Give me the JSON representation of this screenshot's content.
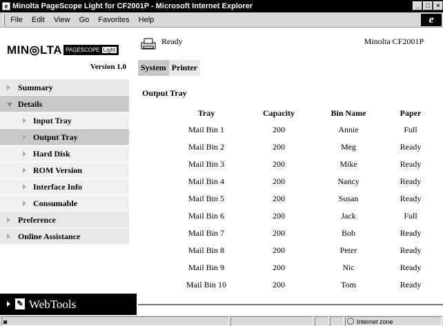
{
  "window": {
    "title": "Minolta PageScope Light for CF2001P - Microsoft Internet Explorer",
    "menu": [
      "File",
      "Edit",
      "View",
      "Go",
      "Favorites",
      "Help"
    ]
  },
  "brand": {
    "logo": "MIN◎LTA",
    "product_name": "PAGESCOPE",
    "product_edition": "Light",
    "version": "Version 1.0"
  },
  "nav": {
    "items": [
      {
        "label": "Summary"
      },
      {
        "label": "Details"
      },
      {
        "label": "Input Tray"
      },
      {
        "label": "Output Tray"
      },
      {
        "label": "Hard Disk"
      },
      {
        "label": "ROM Version"
      },
      {
        "label": "Interface Info"
      },
      {
        "label": "Consumable"
      },
      {
        "label": "Preference"
      },
      {
        "label": "Online Assistance"
      }
    ],
    "webtools_label": "WebTools"
  },
  "status": {
    "text": "Ready",
    "model": "Minolta CF2001P"
  },
  "tabs": [
    {
      "label": "System",
      "active": true
    },
    {
      "label": "Printer",
      "active": false
    }
  ],
  "section_title": "Output Tray",
  "table": {
    "headers": [
      "Tray",
      "Capacity",
      "Bin Name",
      "Paper"
    ],
    "rows": [
      [
        "Mail Bin 1",
        "200",
        "Annie",
        "Full"
      ],
      [
        "Mail Bin 2",
        "200",
        "Meg",
        "Ready"
      ],
      [
        "Mail Bin 3",
        "200",
        "Mike",
        "Ready"
      ],
      [
        "Mail Bin 4",
        "200",
        "Nancy",
        "Ready"
      ],
      [
        "Mail Bin 5",
        "200",
        "Susan",
        "Ready"
      ],
      [
        "Mail Bin 6",
        "200",
        "Jack",
        "Full"
      ],
      [
        "Mail Bin 7",
        "200",
        "Bob",
        "Ready"
      ],
      [
        "Mail Bin 8",
        "200",
        "Peter",
        "Ready"
      ],
      [
        "Mail Bin 9",
        "200",
        "Nic",
        "Ready"
      ],
      [
        "Mail Bin 10",
        "200",
        "Tom",
        "Ready"
      ]
    ]
  },
  "statusbar": {
    "zone": "Internet zone"
  }
}
